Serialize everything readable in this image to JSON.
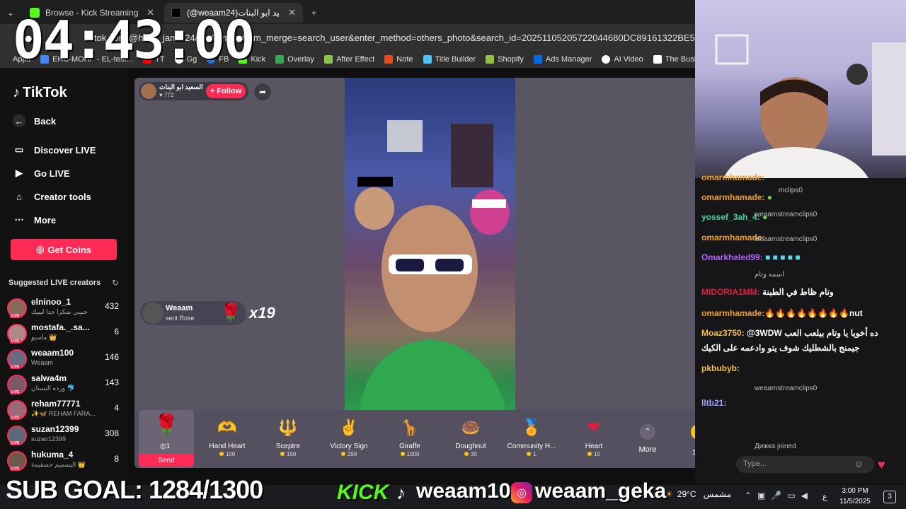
{
  "browser": {
    "tabs": [
      {
        "label": "Browse - Kick Streaming",
        "color": "#53fc18"
      },
      {
        "label": "(@weaam24)السعيد ابو البنات",
        "color": "#111111"
      }
    ],
    "url": "tiktok.com/@hello_jamal24/live?enter_from_merge=search_user&enter_method=others_photo&search_id=20251105205722044680DC89161322BE52&search_keyw",
    "bookmarks": [
      "Apps",
      "EHC-MOHP - EL-test...",
      "YT",
      "Gg",
      "FB",
      "Kick",
      "Overlay",
      "After Effect",
      "Note",
      "Title Builder",
      "Shopify",
      "Ads Manager",
      "AI Video",
      "The Busin"
    ]
  },
  "overlay": {
    "clock": "04:43:00",
    "sub_goal": "SUB GOAL: 1284/1300",
    "kick_label": "KICK",
    "kick_name": "weaam100",
    "ig_name": "weaam_geka"
  },
  "sidebar": {
    "logo": "TikTok",
    "back": "Back",
    "nav": [
      "Discover LIVE",
      "Go LIVE",
      "Creator tools",
      "More"
    ],
    "coins": "Get Coins",
    "suggested_title": "Suggested LIVE creators",
    "creators": [
      {
        "name": "elninoo_1",
        "sub": "حبيبي شكرا جدا ليييك",
        "count": "432",
        "color": "#8a6a5a"
      },
      {
        "name": "mostafa._.sa...",
        "sub": "ماسيو 👑",
        "count": "6",
        "color": "#b08a8a"
      },
      {
        "name": "weaam100",
        "sub": "Weaam",
        "count": "146",
        "color": "#6a6a80"
      },
      {
        "name": "salwa4m",
        "sub": "ورده البستان 🐬",
        "count": "143",
        "color": "#7a5a6a"
      },
      {
        "name": "reham77771",
        "sub": "✨🦋 REHAM FARA...",
        "count": "4",
        "color": "#9a6a7a"
      },
      {
        "name": "suzan12399",
        "sub": "suzan12399",
        "count": "308",
        "color": "#5a6a7a"
      },
      {
        "name": "hukuma_4",
        "sub": "اليسميم جسقيمة 👑",
        "count": "8",
        "color": "#6a5a4a"
      }
    ]
  },
  "live": {
    "host_name": "السعيد ابو البنات",
    "host_views": "772",
    "follow": "+ Follow",
    "gift_notice": {
      "name": "Weaam",
      "sub": "sent Rose",
      "count": "x19"
    },
    "rose_qty": "1",
    "send": "Send",
    "gifts": [
      {
        "name": "Hand Heart",
        "cost": "100",
        "icon": "🫶"
      },
      {
        "name": "Sceptre",
        "cost": "150",
        "icon": "🔱"
      },
      {
        "name": "Victory Sign",
        "cost": "299",
        "icon": "✌"
      },
      {
        "name": "Giraffe",
        "cost": "1000",
        "icon": "🦒"
      },
      {
        "name": "Doughnut",
        "cost": "30",
        "icon": "🍩"
      },
      {
        "name": "Community H...",
        "cost": "1",
        "icon": "🏅"
      },
      {
        "name": "Heart",
        "cost": "10",
        "icon": "❤"
      }
    ],
    "more": "More",
    "side_count": "11"
  },
  "chat": {
    "messages": [
      {
        "user": "omarmhamade:",
        "color": "#f0a020",
        "text": ""
      },
      {
        "user": "omarmhamade:",
        "color": "#f0a020",
        "text": ""
      },
      {
        "user": "yossef_3ah_4:",
        "color": "#40d0a0",
        "text": ""
      },
      {
        "user": "omarmhamade:",
        "color": "#f0a020",
        "text": ""
      },
      {
        "user": "Omarkhaled99:",
        "color": "#b060ff",
        "text": ""
      },
      {
        "user": "MIDORIA1MM:",
        "color": "#e02040",
        "text": "وتام ظاط في الطبنة"
      },
      {
        "user": "omarmhamade:",
        "color": "#f0a020",
        "text": "🔥🔥🔥🔥🔥🔥🔥🔥nut"
      },
      {
        "user": "Moaz3750:",
        "color": "#f0c040",
        "text": "@3WDW ده أخويا يا وتام بيلعب العب"
      },
      {
        "user": "",
        "color": "#ffffff",
        "text": "جيمنج بالشطليك شوف يتو وادعمه على الكيك"
      },
      {
        "user": "pkbubyb:",
        "color": "#f0c040",
        "text": ""
      },
      {
        "user": "lltb21:",
        "color": "#a0a0ff",
        "text": ""
      }
    ],
    "subs": [
      "mclips0",
      "weaamstreamclips0",
      "weaamstreamclips0",
      "اسمه وتام",
      "weaamstreamclips0",
      "Дижка joined"
    ],
    "type_placeholder": "Type..."
  },
  "taskbar": {
    "temp": "29°C",
    "weather_text": "مشمس",
    "lang": "ع",
    "time": "3:00 PM",
    "date": "11/5/2025",
    "notif": "3"
  }
}
